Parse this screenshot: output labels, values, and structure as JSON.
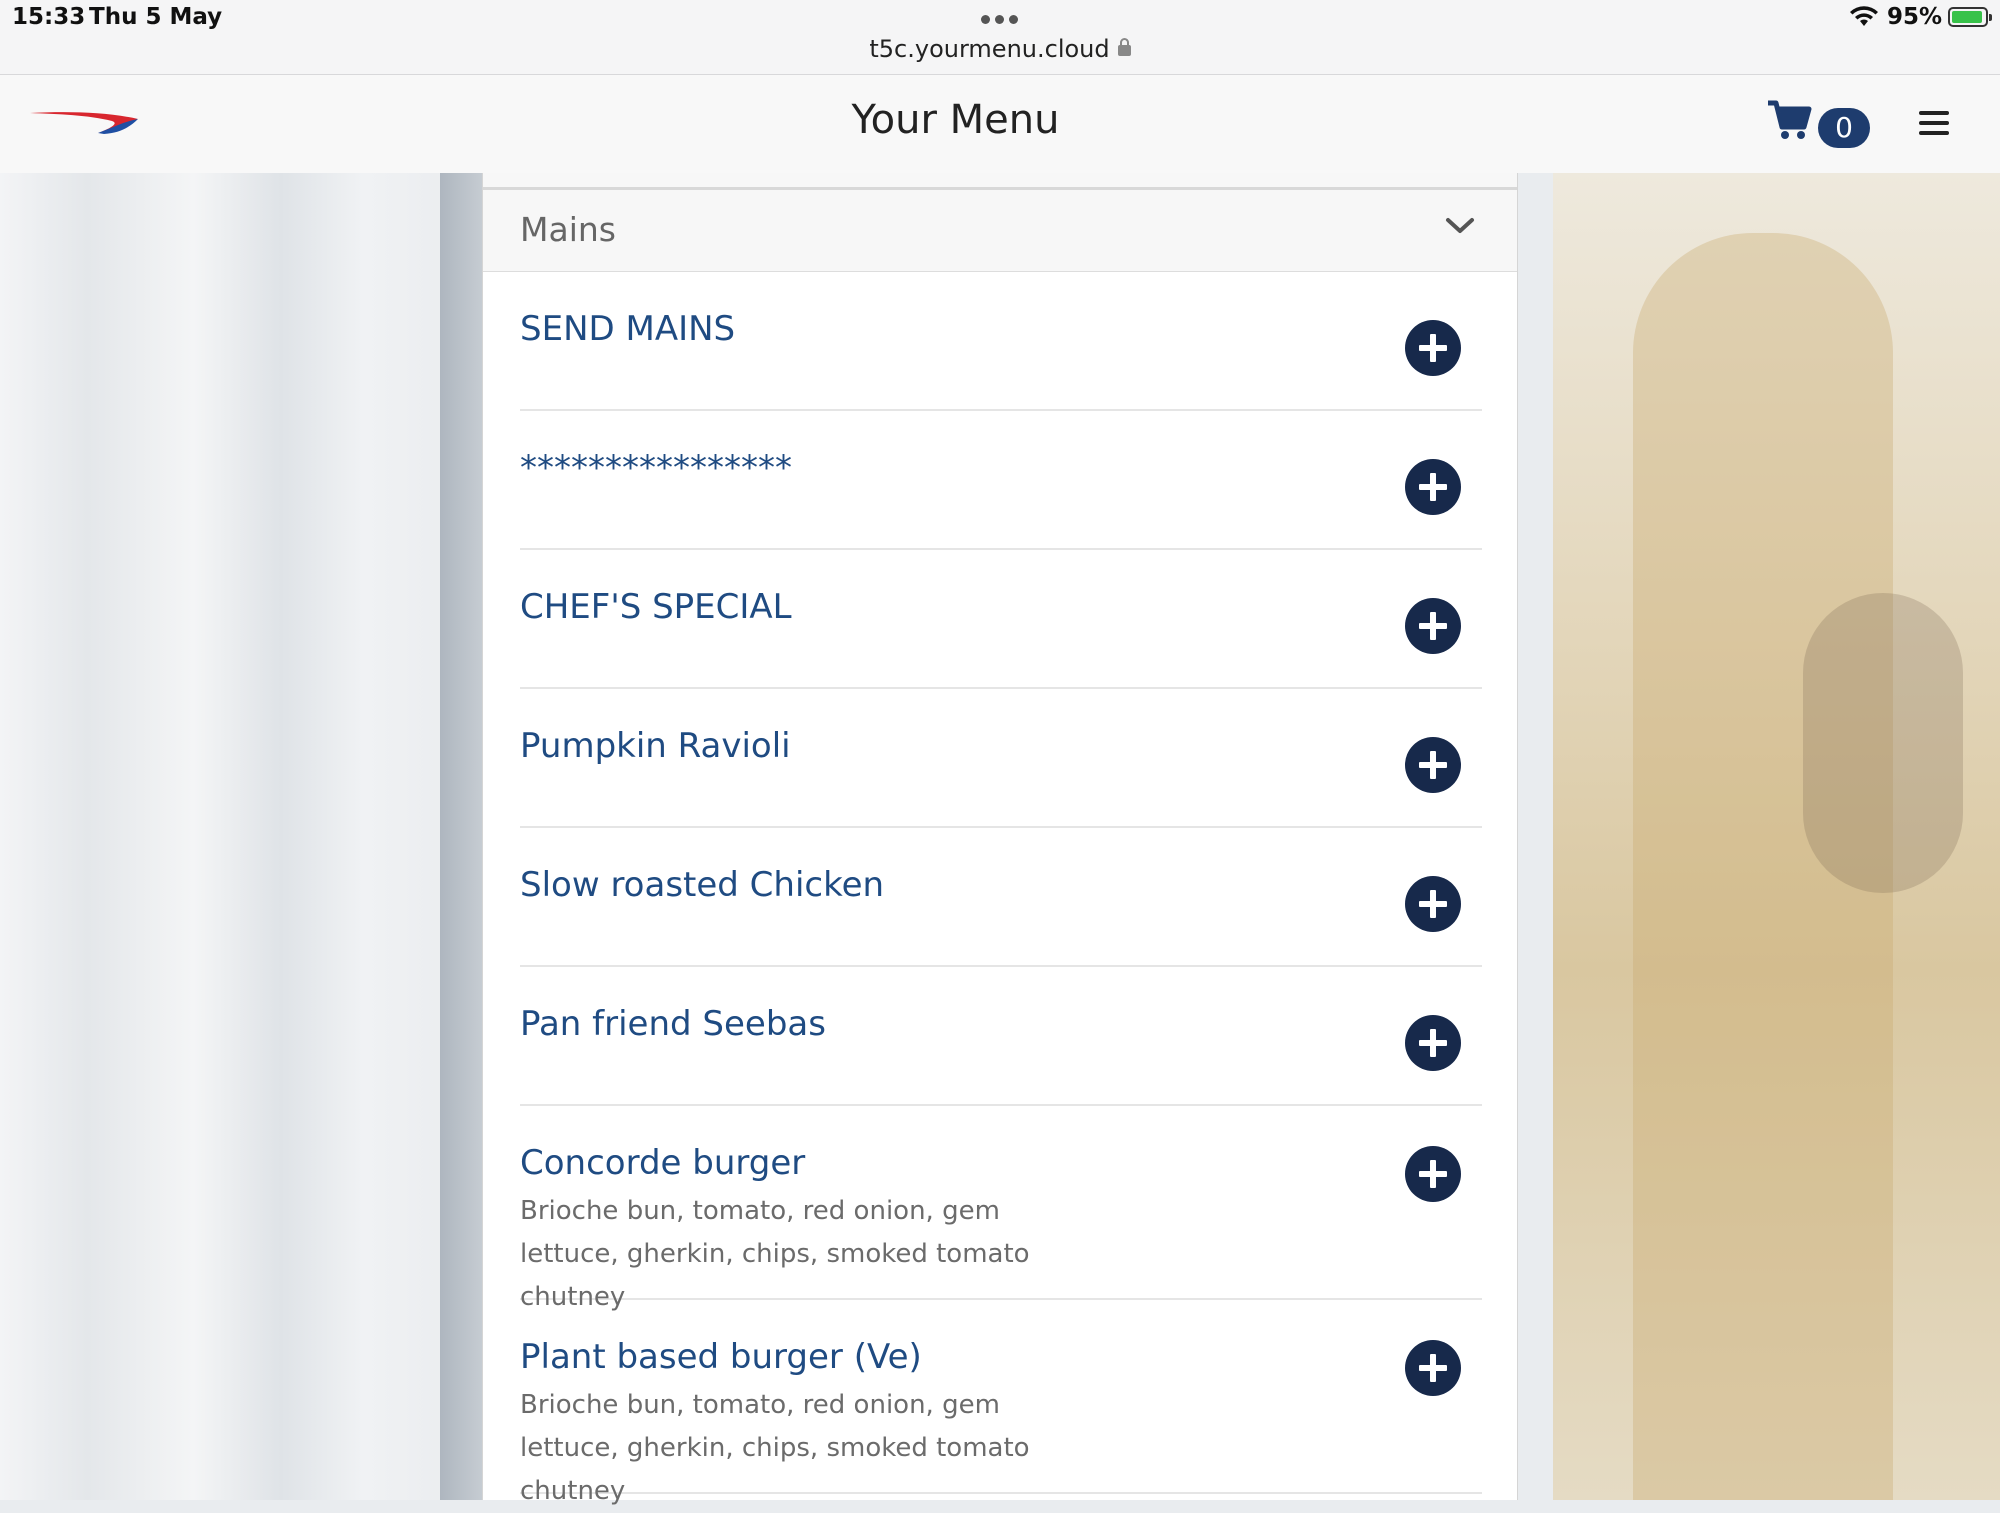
{
  "status_bar": {
    "time": "15:33",
    "date": "Thu 5 May",
    "url": "t5c.yourmenu.cloud",
    "battery": "95%"
  },
  "navbar": {
    "title": "Your Menu",
    "cart_count": "0"
  },
  "section": {
    "title": "Mains"
  },
  "items": [
    {
      "name": "SEND MAINS",
      "description": ""
    },
    {
      "name": "****************",
      "description": ""
    },
    {
      "name": "CHEF'S SPECIAL",
      "description": ""
    },
    {
      "name": "Pumpkin Ravioli",
      "description": ""
    },
    {
      "name": "Slow roasted Chicken",
      "description": ""
    },
    {
      "name": "Pan friend Seebas",
      "description": ""
    },
    {
      "name": "Concorde burger",
      "description": "Brioche bun, tomato, red onion, gem lettuce, gherkin, chips, smoked tomato chutney"
    },
    {
      "name": "Plant based burger (Ve)",
      "description": "Brioche bun, tomato, red onion, gem lettuce, gherkin, chips, smoked tomato chutney"
    }
  ],
  "colors": {
    "accent": "#1f4b82",
    "button": "#17294b",
    "badge": "#1e3c6e"
  },
  "icons": [
    "logo-icon",
    "cart-icon",
    "hamburger-icon",
    "chevron-down-icon",
    "plus-icon",
    "lock-icon",
    "wifi-icon",
    "battery-icon"
  ]
}
